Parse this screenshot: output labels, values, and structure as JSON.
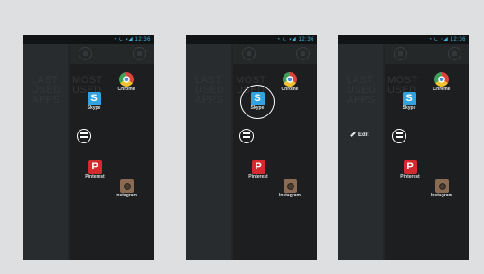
{
  "status": {
    "time": "12:36",
    "icons": "◔ ⏾ ▾◢"
  },
  "ghost": {
    "last_used_apps": "LAST USED APPS",
    "most_used": "MOST USED"
  },
  "apps": {
    "chrome": "Chrome",
    "skype": "Skype",
    "pinterest": "Pinterest",
    "instagram": "Instagram"
  },
  "edit_label": "Edit",
  "colors": {
    "background": "#dedfe0",
    "phone_bg": "#222527",
    "status_accent": "#3fb3dd",
    "skype": "#33a3e0",
    "pinterest": "#d4292e"
  },
  "icon_names": [
    "chrome-icon",
    "skype-icon",
    "pinterest-icon",
    "instagram-icon",
    "menu-icon",
    "pencil-icon"
  ]
}
